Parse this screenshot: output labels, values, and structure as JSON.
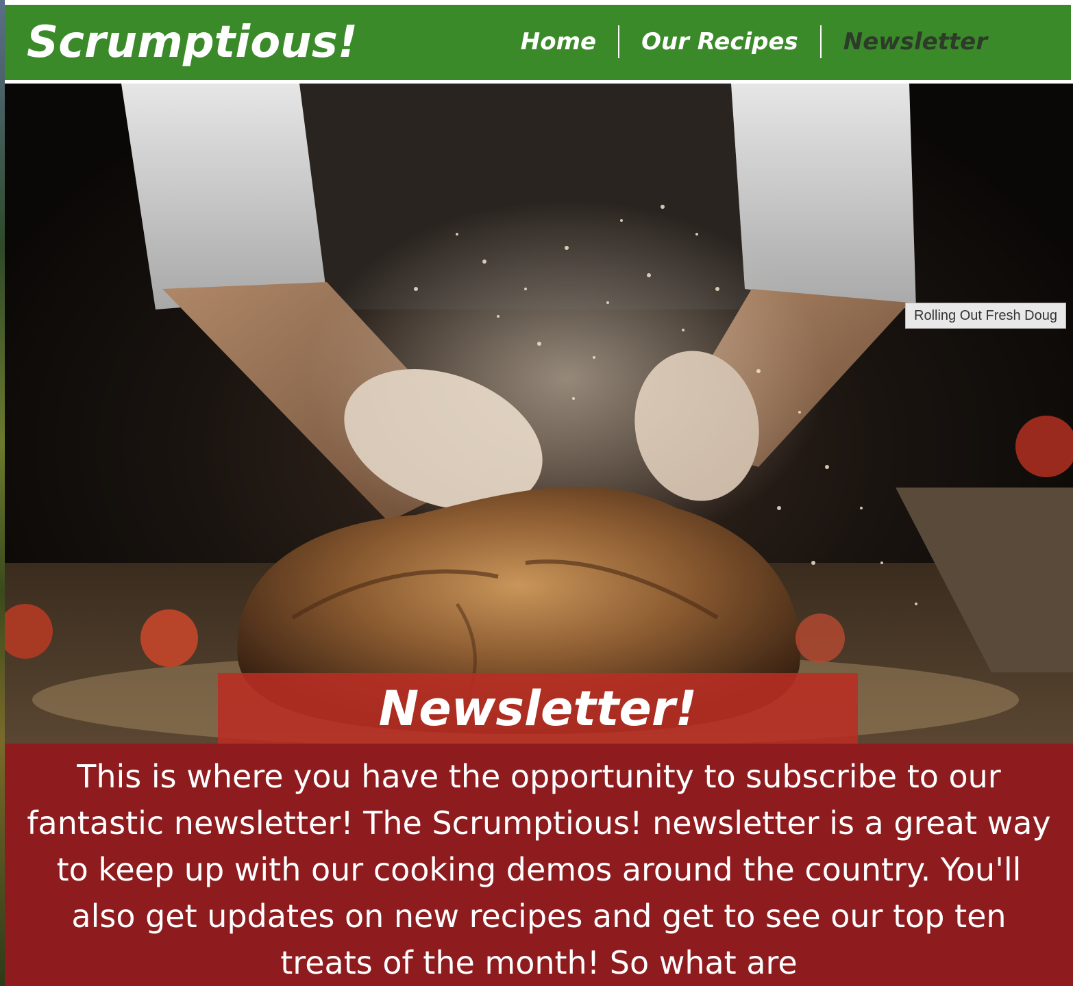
{
  "header": {
    "logo": "Scrumptious!",
    "nav": [
      {
        "label": "Home",
        "active": false
      },
      {
        "label": "Our Recipes",
        "active": false
      },
      {
        "label": "Newsletter",
        "active": true
      }
    ]
  },
  "hero": {
    "image_tooltip": "Rolling Out Fresh Doug",
    "title": "Newsletter!"
  },
  "body": {
    "paragraph": "This is where you have the opportunity to subscribe to our fantastic newsletter! The Scrumptious! newsletter is a great way to keep up with our cooking demos around the country. You'll also get updates on new recipes and get to see our top ten treats of the month! So what are"
  },
  "colors": {
    "header_green": "#3a8a2a",
    "title_red": "#b92d23",
    "body_red": "#8e1c1f",
    "active_nav": "#2e3a2a"
  }
}
